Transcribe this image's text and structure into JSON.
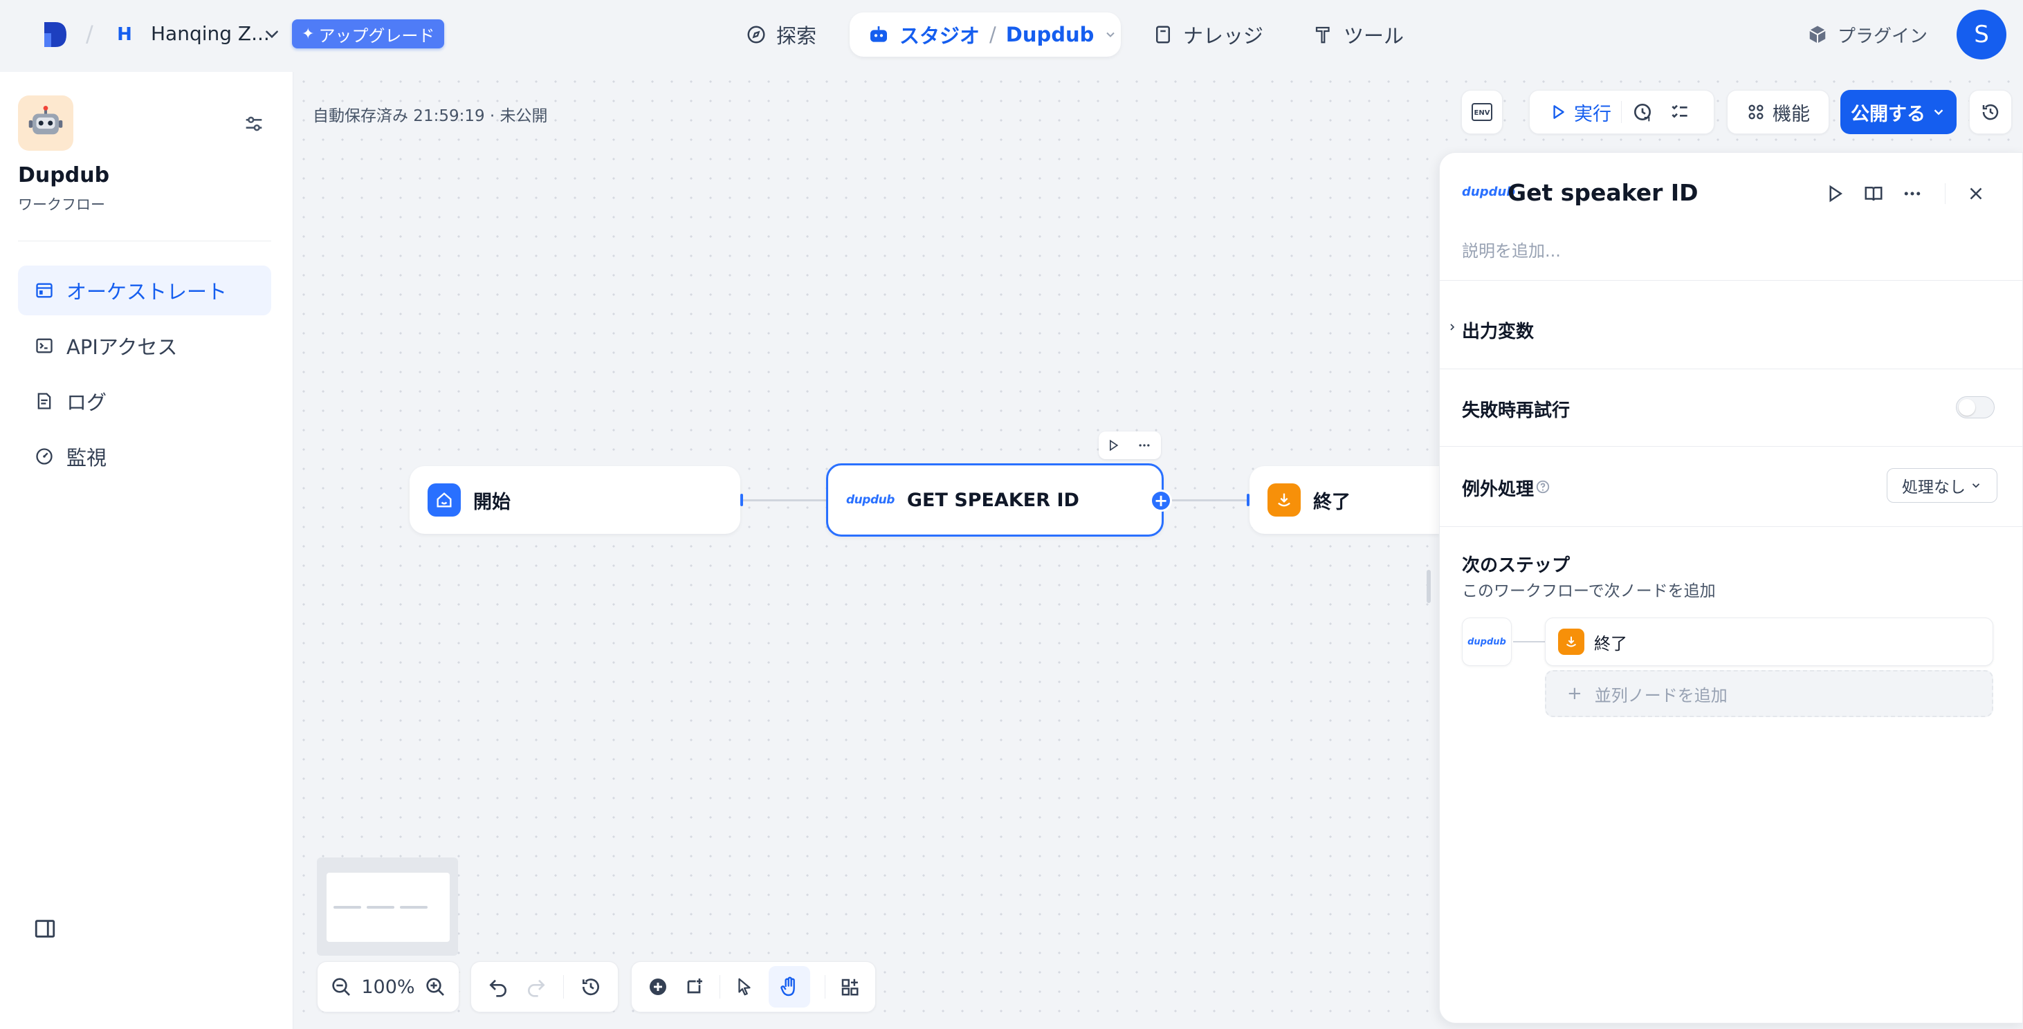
{
  "topbar": {
    "workspace_initial": "H",
    "workspace_name": "Hanqing Z...",
    "upgrade_label": "アップグレード",
    "nav_explore": "探索",
    "nav_studio": "スタジオ",
    "nav_app": "Dupdub",
    "nav_knowledge": "ナレッジ",
    "nav_tools": "ツール",
    "plugins": "プラグイン",
    "user_initial": "S"
  },
  "sidebar": {
    "app_name": "Dupdub",
    "app_type": "ワークフロー",
    "items": [
      {
        "label": "オーケストレート",
        "icon": "layout-icon",
        "active": true
      },
      {
        "label": "APIアクセス",
        "icon": "terminal-icon",
        "active": false
      },
      {
        "label": "ログ",
        "icon": "log-file-icon",
        "active": false
      },
      {
        "label": "監視",
        "icon": "gauge-icon",
        "active": false
      }
    ]
  },
  "canvas": {
    "autosave_status": "自動保存済み 21:59:19 · 未公開",
    "toolbar": {
      "env": "ENV",
      "run": "実行",
      "features": "機能",
      "publish": "公開する"
    },
    "nodes": {
      "start": "開始",
      "tool": "GET SPEAKER ID",
      "end": "終了"
    },
    "zoom": "100%"
  },
  "panel": {
    "title": "Get speaker ID",
    "description_placeholder": "説明を追加...",
    "output_vars": "出力変数",
    "retry_on_fail": "失敗時再試行",
    "retry_enabled": false,
    "error_handling": "例外処理",
    "error_handling_value": "処理なし",
    "next_step_title": "次のステップ",
    "next_step_desc": "このワークフローで次ノードを追加",
    "next_node": "終了",
    "add_parallel": "並列ノードを追加"
  },
  "colors": {
    "accent": "#155eef",
    "end_node": "#f79009",
    "start_node": "#2970ff"
  }
}
